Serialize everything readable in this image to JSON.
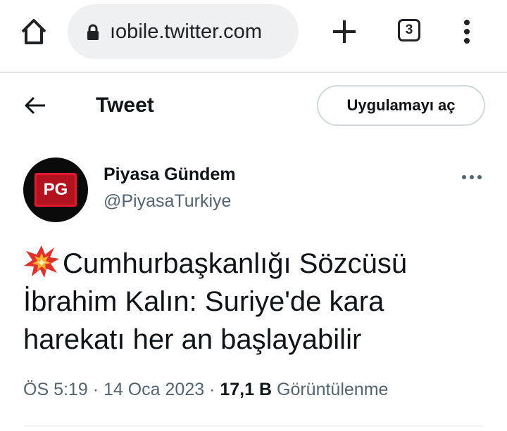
{
  "browser": {
    "url": "ıobile.twitter.com",
    "tab_count": "3"
  },
  "header": {
    "title": "Tweet",
    "open_app_label": "Uygulamayı aç"
  },
  "author": {
    "avatar_text": "PG",
    "name": "Piyasa Gündem",
    "handle": "@PiyasaTurkiye"
  },
  "tweet": {
    "lead_icon": "collision-icon",
    "text": "Cumhurbaşkanlığı Sözcüsü İbrahim Kalın: Suriye'de kara harekatı her an başlayabilir",
    "time": "ÖS 5:19",
    "separator": "·",
    "date": "14 Oca 2023",
    "views_count": "17,1 B",
    "views_label": "Görüntülenme"
  },
  "colors": {
    "secondary_text": "#536471",
    "border": "#cfd9de",
    "avatar_accent": "#e1182e",
    "collision_icon": "#e0312c"
  }
}
